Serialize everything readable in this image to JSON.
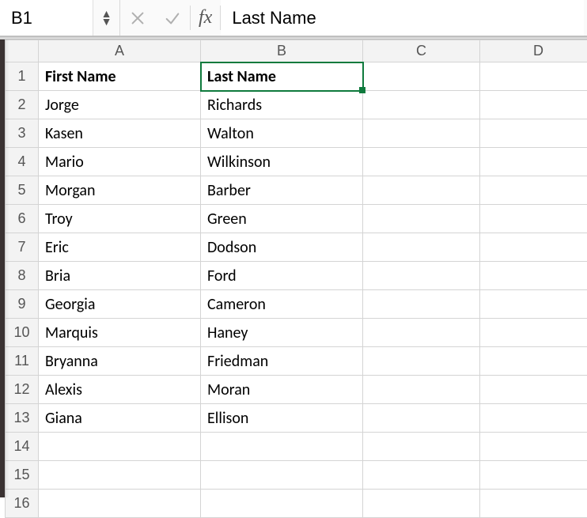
{
  "formula_bar": {
    "name_box": "B1",
    "fx_label": "fx",
    "content": "Last Name"
  },
  "columns": [
    "A",
    "B",
    "C",
    "D"
  ],
  "row_count": 16,
  "selection": {
    "col": "B",
    "row": 1
  },
  "chart_data": {
    "type": "table",
    "title": "",
    "columns": [
      "First Name",
      "Last Name"
    ],
    "rows": [
      [
        "Jorge",
        "Richards"
      ],
      [
        "Kasen",
        "Walton"
      ],
      [
        "Mario",
        "Wilkinson"
      ],
      [
        "Morgan",
        "Barber"
      ],
      [
        "Troy",
        "Green"
      ],
      [
        "Eric",
        "Dodson"
      ],
      [
        "Bria",
        "Ford"
      ],
      [
        "Georgia",
        "Cameron"
      ],
      [
        "Marquis",
        "Haney"
      ],
      [
        "Bryanna",
        "Friedman"
      ],
      [
        "Alexis",
        "Moran"
      ],
      [
        "Giana",
        "Ellison"
      ]
    ]
  }
}
